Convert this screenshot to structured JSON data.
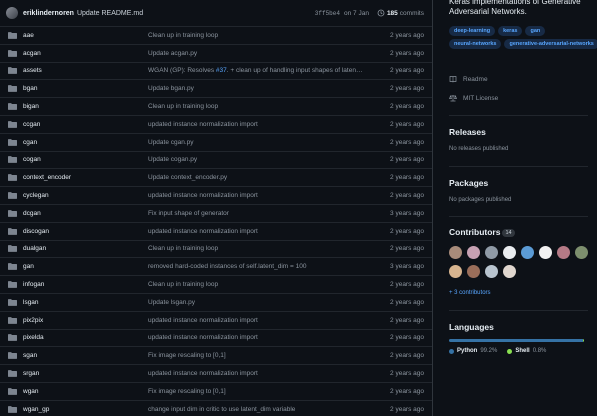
{
  "commit": {
    "author": "eriklindernoren",
    "message": "Update README.md",
    "sha": "3ff5be4",
    "date": "on 7 Jan",
    "commit_count": "185",
    "commits_label": "commits"
  },
  "files": [
    {
      "name": "aae",
      "message": "Clean up in training loop",
      "age": "2 years ago"
    },
    {
      "name": "acgan",
      "message": "Update acgan.py",
      "age": "2 years ago"
    },
    {
      "name": "assets",
      "message_pre": "WGAN (GP): Resolves ",
      "issue": "#37",
      "message_post": ". + clean up of handling input shapes of laten…",
      "age": "2 years ago"
    },
    {
      "name": "bgan",
      "message": "Update bgan.py",
      "age": "2 years ago"
    },
    {
      "name": "bigan",
      "message": "Clean up in training loop",
      "age": "2 years ago"
    },
    {
      "name": "ccgan",
      "message": "updated instance normalization import",
      "age": "2 years ago"
    },
    {
      "name": "cgan",
      "message": "Update cgan.py",
      "age": "2 years ago"
    },
    {
      "name": "cogan",
      "message": "Update cogan.py",
      "age": "2 years ago"
    },
    {
      "name": "context_encoder",
      "message": "Update context_encoder.py",
      "age": "2 years ago"
    },
    {
      "name": "cyclegan",
      "message": "updated instance normalization import",
      "age": "2 years ago"
    },
    {
      "name": "dcgan",
      "message": "Fix input shape of generator",
      "age": "3 years ago"
    },
    {
      "name": "discogan",
      "message": "updated instance normalization import",
      "age": "2 years ago"
    },
    {
      "name": "dualgan",
      "message": "Clean up in training loop",
      "age": "2 years ago"
    },
    {
      "name": "gan",
      "message": "removed hard-coded instances of self.latent_dim = 100",
      "age": "3 years ago"
    },
    {
      "name": "infogan",
      "message": "Clean up in training loop",
      "age": "2 years ago"
    },
    {
      "name": "lsgan",
      "message": "Update lsgan.py",
      "age": "2 years ago"
    },
    {
      "name": "pix2pix",
      "message": "updated instance normalization import",
      "age": "2 years ago"
    },
    {
      "name": "pixelda",
      "message": "updated instance normalization import",
      "age": "2 years ago"
    },
    {
      "name": "sgan",
      "message": "Fix image rescaling to [0,1]",
      "age": "2 years ago"
    },
    {
      "name": "srgan",
      "message": "updated instance normalization import",
      "age": "2 years ago"
    },
    {
      "name": "wgan",
      "message": "Fix image rescaling to [0,1]",
      "age": "2 years ago"
    },
    {
      "name": "wgan_gp",
      "message": "change input dim in critic to use latent_dim variable",
      "age": "2 years ago"
    }
  ],
  "about": {
    "description": "Keras implementations of Generative Adversarial Networks.",
    "topics": [
      "deep-learning",
      "keras",
      "gan",
      "neural-networks",
      "generative-adversarial-networks"
    ],
    "readme_label": "Readme",
    "license_label": "MIT License"
  },
  "releases": {
    "title": "Releases",
    "note": "No releases published"
  },
  "packages": {
    "title": "Packages",
    "note": "No packages published"
  },
  "contributors": {
    "title": "Contributors",
    "count": "14",
    "more_label": "+ 3 contributors",
    "avatar_colors": [
      "#a88b7a",
      "#c7a1b3",
      "#8f9aa6",
      "#e9ecef",
      "#5b9bd5",
      "#f1f1f1",
      "#b57a86",
      "#7d8f6e",
      "#d7b48f",
      "#9a6e5a",
      "#b8c4cf",
      "#e0d7cf"
    ]
  },
  "languages": {
    "title": "Languages",
    "items": [
      {
        "name": "Python",
        "percent": "99.2%",
        "color": "#3572a5",
        "share": 0.992
      },
      {
        "name": "Shell",
        "percent": "0.8%",
        "color": "#89e051",
        "share": 0.008
      }
    ]
  }
}
